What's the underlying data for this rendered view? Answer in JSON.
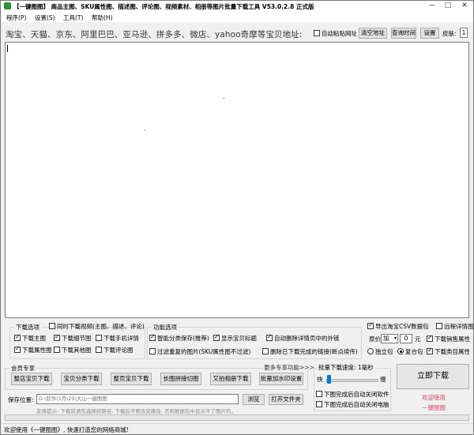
{
  "window": {
    "title": "【一键图图】 商品主图、SKU属性图、描述图、评论图、视频素材、相册等图片批量下载工具 V53.0.2.8 正式版",
    "minimize": "—",
    "maximize": "□",
    "close": "✕"
  },
  "menu": [
    "程序(P)",
    "设置(S)",
    "工具(T)",
    "帮助(H)"
  ],
  "toolbar": {
    "url_label": "淘宝、天猫、京东、阿里巴巴、亚马逊、拼多多、微店、yahoo奇摩等宝贝地址:",
    "auto_paste_label": "自动粘贴网址",
    "auto_paste_checked": false,
    "clear_button": "清空地址",
    "query_time_button": "查询时间",
    "settings_button": "设置",
    "skin_label": "皮肤:",
    "skin_value": "1"
  },
  "download_options": {
    "legend": "下载选项",
    "video_option": {
      "label": "同时下载视频(主图、描述、评论)",
      "checked": false
    },
    "row1": [
      {
        "label": "下载主图",
        "checked": true
      },
      {
        "label": "下载细节图",
        "checked": true
      },
      {
        "label": "下载手机详情",
        "checked": false
      }
    ],
    "row2": [
      {
        "label": "下载属性图",
        "checked": true
      },
      {
        "label": "下载其他图",
        "checked": false
      },
      {
        "label": "下载评论图",
        "checked": false
      }
    ]
  },
  "function_options": {
    "legend": "功能选项",
    "row1": [
      {
        "label": "智能分类保存(推荐)",
        "checked": true
      },
      {
        "label": "显示宝贝标题",
        "checked": true
      },
      {
        "label": "自动删除详情页中的外链",
        "checked": true
      }
    ],
    "row2": [
      {
        "label": "过滤重复的图片(SKU属性图不过滤)",
        "checked": false
      },
      {
        "label": "删除已下载完成的链接(断点续传)",
        "checked": false
      }
    ]
  },
  "right_options": {
    "export_csv": {
      "label": "导出淘宝CSV数据包",
      "checked": true
    },
    "remote_detail": {
      "label": "远程详情图",
      "checked": false
    },
    "price_label": "原价",
    "price_op": "加",
    "price_value": "0",
    "price_unit": "元",
    "download_sales_attr": {
      "label": "下载销售属性",
      "checked": true
    },
    "single_pack": {
      "label": "独立包",
      "selected": false
    },
    "combined_pack": {
      "label": "复合包",
      "selected": true
    },
    "download_category_attr": {
      "label": "下载类目属性",
      "checked": true
    }
  },
  "member": {
    "legend": "会员专享",
    "more": "更多专享功能>>>",
    "buttons": [
      "整店宝贝下载",
      "宝贝分类下载",
      "整页宝贝下载",
      "长图拼接切图",
      "又拍相册下载",
      "批量加水印设置"
    ]
  },
  "save": {
    "label": "保存位置:",
    "path": "D:\\软件\\5月\\25\\大山一键图图",
    "browse_button": "浏览",
    "open_button": "打开文件夹",
    "tip": "友情提示: 下载前请先选择好路径, 下载后不要改变路径, 否则数据包中显示不了图片的。"
  },
  "speed": {
    "legend": "批量下载速度: 1毫秒",
    "fast": "快",
    "slow": "慢",
    "close_software": {
      "label": "下图完成后自动关闭软件",
      "checked": false
    },
    "shutdown": {
      "label": "下图完成后自动关闭电脑",
      "checked": false
    }
  },
  "start_button": "立即下载",
  "welcome_lines": [
    "欢迎使用",
    "一键图图"
  ],
  "status": "欢迎使用《一键图图》, 快速打造您的网络商城!",
  "colors": {
    "accent_pink": "#d9486c",
    "title_icon": "#2f8f3a"
  }
}
